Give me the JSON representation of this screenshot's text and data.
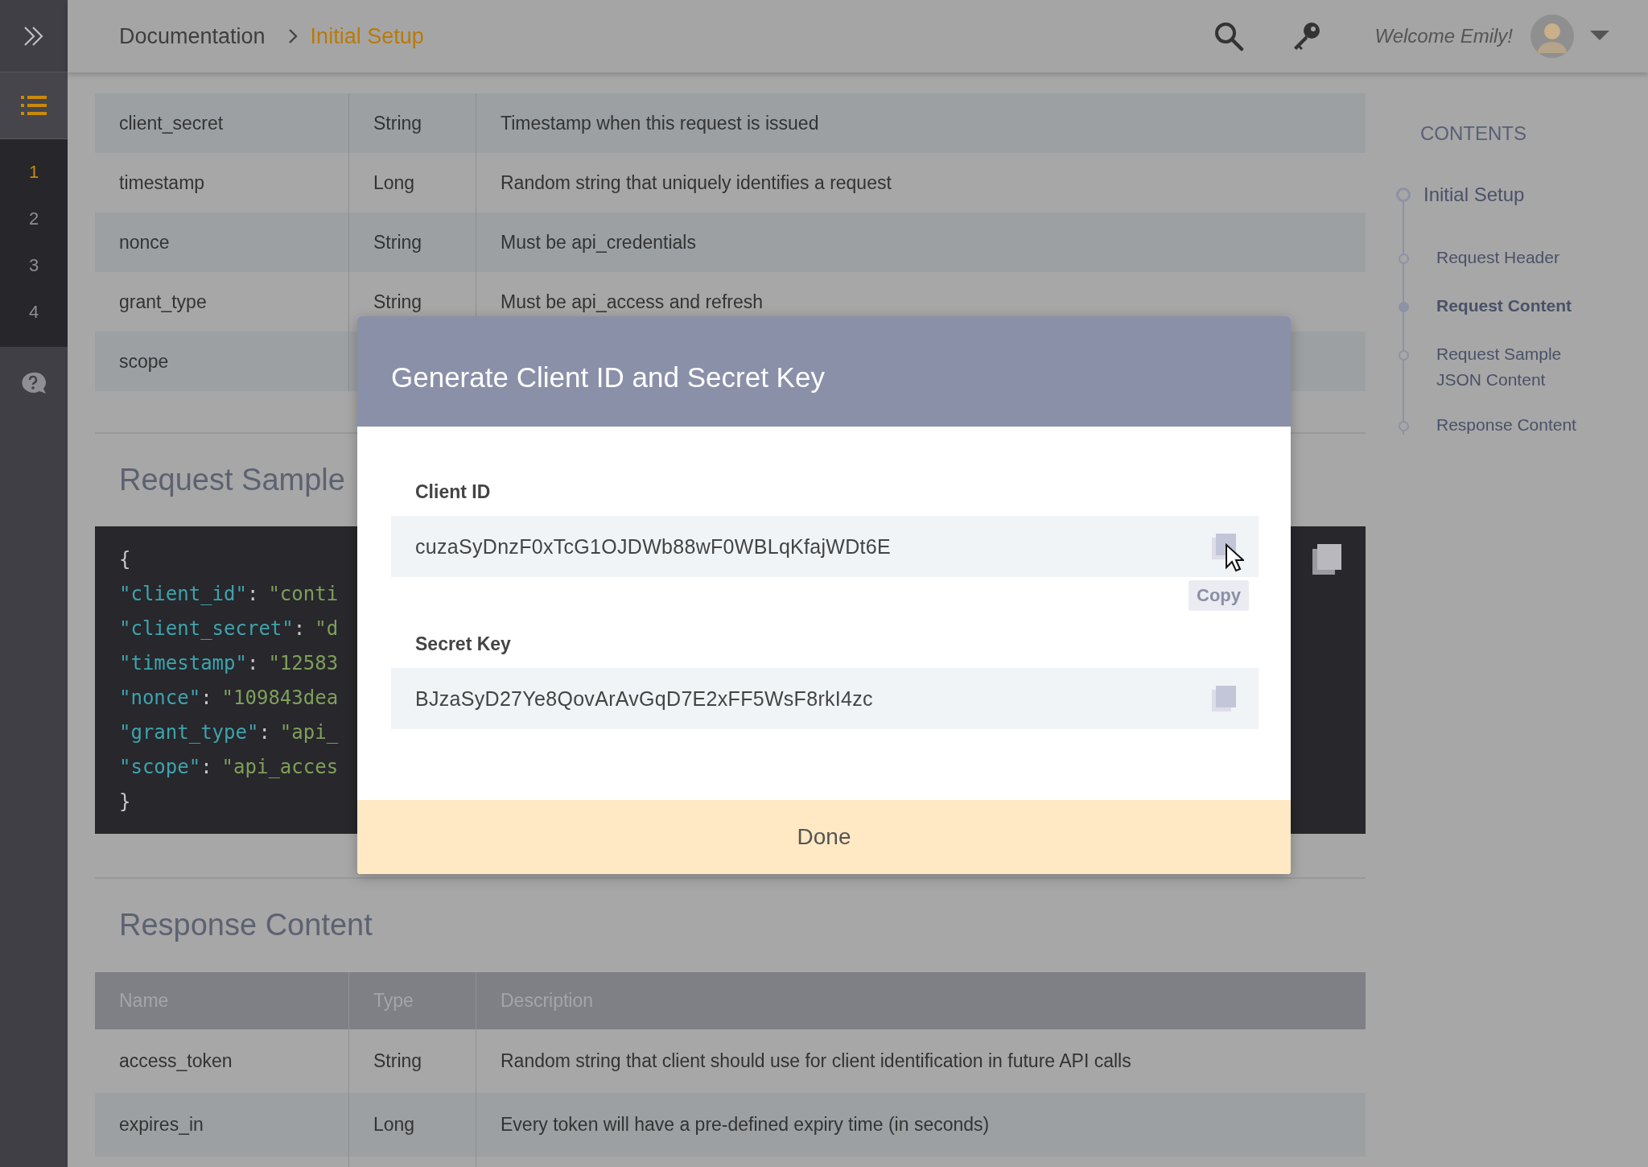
{
  "sidebar": {
    "items": [
      {
        "label": "1",
        "selected": true
      },
      {
        "label": "2",
        "selected": false
      },
      {
        "label": "3",
        "selected": false
      },
      {
        "label": "4",
        "selected": false
      }
    ]
  },
  "header": {
    "breadcrumb": [
      "Documentation",
      "Initial Setup"
    ],
    "welcome": "Welcome Emily!"
  },
  "request_table": {
    "rows": [
      {
        "name": "client_secret",
        "type": "String",
        "description": "Timestamp when this request is issued"
      },
      {
        "name": "timestamp",
        "type": "Long",
        "description": "Random string that uniquely identifies a request"
      },
      {
        "name": "nonce",
        "type": "String",
        "description": "Must be api_credentials"
      },
      {
        "name": "grant_type",
        "type": "String",
        "description": "Must be api_access and refresh"
      },
      {
        "name": "scope"
      }
    ]
  },
  "request_sample": {
    "heading": "Request Sample",
    "open": "{",
    "close": "}",
    "lines": [
      {
        "key": "\"client_id\"",
        "punct": ":",
        "value": "\"conti"
      },
      {
        "key": "\"client_secret\"",
        "punct": ":",
        "value": "\"d"
      },
      {
        "key": "\"timestamp\"",
        "punct": ":",
        "value": "\"12583"
      },
      {
        "key": "\"nonce\"",
        "punct": ":",
        "value": "\"109843dea"
      },
      {
        "key": "\"grant_type\"",
        "punct": ":",
        "value": "\"api_"
      },
      {
        "key": "\"scope\"",
        "punct": ":",
        "value": "\"api_acces"
      }
    ]
  },
  "response_content": {
    "heading": "Response Content",
    "columns": [
      "Name",
      "Type",
      "Description"
    ],
    "rows": [
      {
        "name": "access_token",
        "type": "String",
        "description": "Random string that client should use for client identification in future API calls"
      },
      {
        "name": "expires_in",
        "type": "Long",
        "description": "Every token will have a pre-defined expiry time (in seconds)"
      }
    ]
  },
  "contents": {
    "title": "CONTENTS",
    "items": [
      {
        "label": "Initial Setup",
        "selected": false,
        "children": [
          {
            "label": "Request Header",
            "selected": false
          },
          {
            "label": "Request Content",
            "selected": true
          },
          {
            "label": "Request Sample JSON Content",
            "selected": false
          },
          {
            "label": "Response Content",
            "selected": false
          }
        ]
      }
    ]
  },
  "modal": {
    "title": "Generate Client ID and Secret Key",
    "fields": [
      {
        "label": "Client ID",
        "value": "cuzaSyDnzF0xTcG1OJDWb88wF0WBLqKfajWDt6E",
        "tooltip": "Copy"
      },
      {
        "label": "Secret Key",
        "value": "BJzaSyD27Ye8QovArAvGqD7E2xFF5WsF8rkI4zc"
      }
    ],
    "button": "Done"
  }
}
